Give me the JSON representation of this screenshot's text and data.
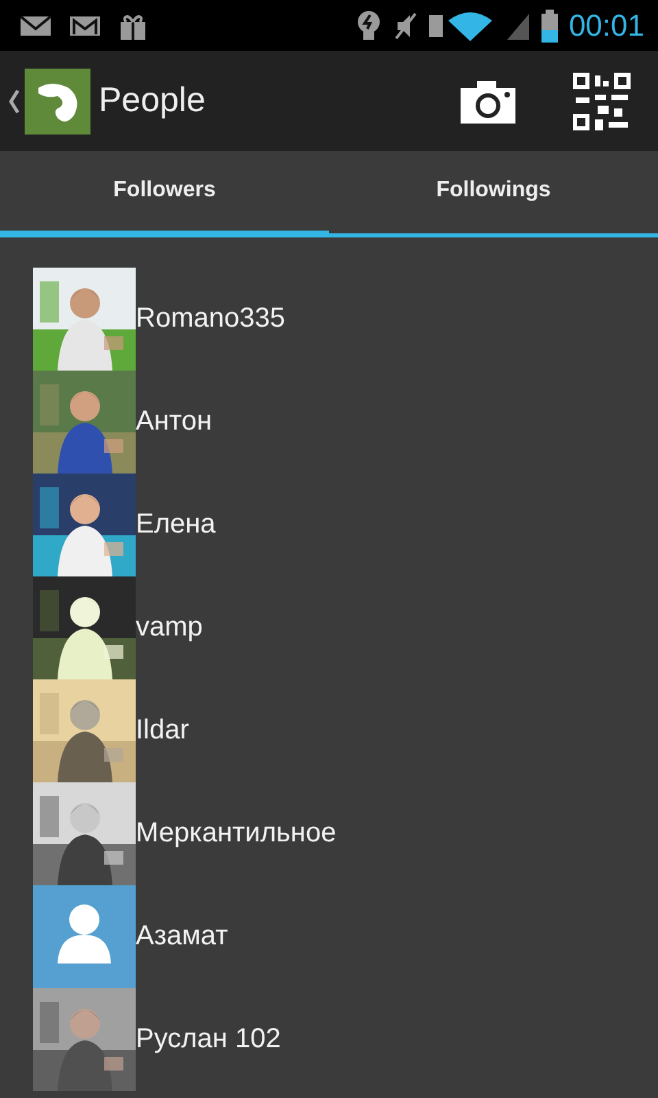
{
  "status_bar": {
    "time": "00:01"
  },
  "action_bar": {
    "title": "People"
  },
  "tabs": [
    {
      "label": "Followers",
      "selected": true
    },
    {
      "label": "Followings",
      "selected": false
    }
  ],
  "people": [
    {
      "name": "Romano335",
      "kind": "picture"
    },
    {
      "name": "Антон",
      "kind": "picture"
    },
    {
      "name": "Елена",
      "kind": "picture"
    },
    {
      "name": "vamp",
      "kind": "picture"
    },
    {
      "name": "Ildar",
      "kind": "picture"
    },
    {
      "name": "Меркантильное",
      "kind": "picture"
    },
    {
      "name": "Азамат",
      "kind": "placeholder"
    },
    {
      "name": "Руслан 102",
      "kind": "picture"
    }
  ]
}
